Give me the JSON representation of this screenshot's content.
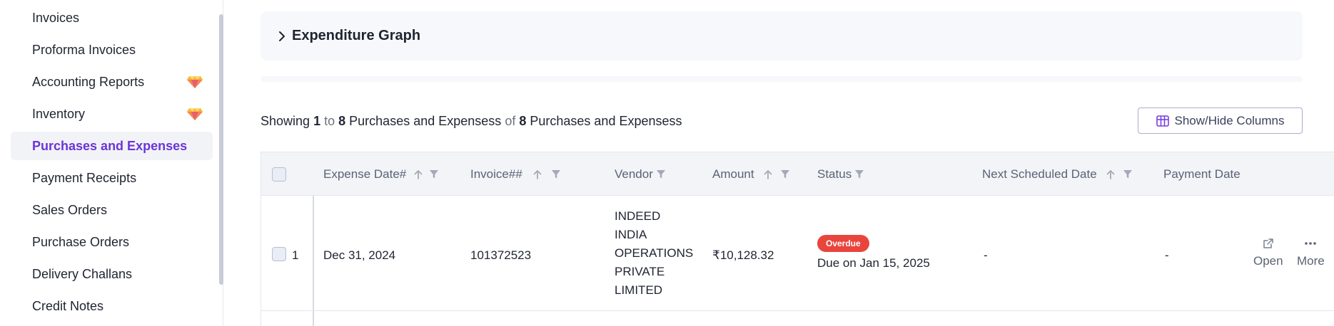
{
  "sidebar": {
    "items": [
      {
        "label": "Invoices",
        "premium": false,
        "active": false
      },
      {
        "label": "Proforma Invoices",
        "premium": false,
        "active": false
      },
      {
        "label": "Accounting Reports",
        "premium": true,
        "active": false
      },
      {
        "label": "Inventory",
        "premium": true,
        "active": false
      },
      {
        "label": "Purchases and Expenses",
        "premium": false,
        "active": true
      },
      {
        "label": "Payment Receipts",
        "premium": false,
        "active": false
      },
      {
        "label": "Sales Orders",
        "premium": false,
        "active": false
      },
      {
        "label": "Purchase Orders",
        "premium": false,
        "active": false
      },
      {
        "label": "Delivery Challans",
        "premium": false,
        "active": false
      },
      {
        "label": "Credit Notes",
        "premium": false,
        "active": false
      }
    ]
  },
  "graph": {
    "title": "Expenditure Graph"
  },
  "summary": {
    "prefix": "Showing",
    "from": "1",
    "to_word": "to",
    "to": "8",
    "entity": "Purchases and Expensess",
    "of_word": "of",
    "total": "8",
    "entity2": "Purchases and Expensess"
  },
  "columns_button": {
    "label": "Show/Hide Columns"
  },
  "table": {
    "headers": {
      "expense_date": "Expense Date#",
      "invoice": "Invoice##",
      "vendor": "Vendor",
      "amount": "Amount",
      "status": "Status",
      "next_scheduled": "Next Scheduled Date",
      "payment_date": "Payment Date"
    },
    "rows": [
      {
        "index": "1",
        "expense_date": "Dec 31, 2024",
        "invoice": "101372523",
        "vendor_lines": [
          "INDEED",
          "INDIA",
          "OPERATIONS",
          "PRIVATE",
          "LIMITED"
        ],
        "amount": "₹10,128.32",
        "status_badge": "Overdue",
        "status_due": "Due on Jan 15, 2025",
        "next_scheduled": "-",
        "payment_date": "-",
        "actions": {
          "open": "Open",
          "more": "More"
        }
      }
    ]
  },
  "colors": {
    "accent": "#6b35d9",
    "overdue": "#e8453c",
    "header_bg": "#f2f4f7"
  }
}
